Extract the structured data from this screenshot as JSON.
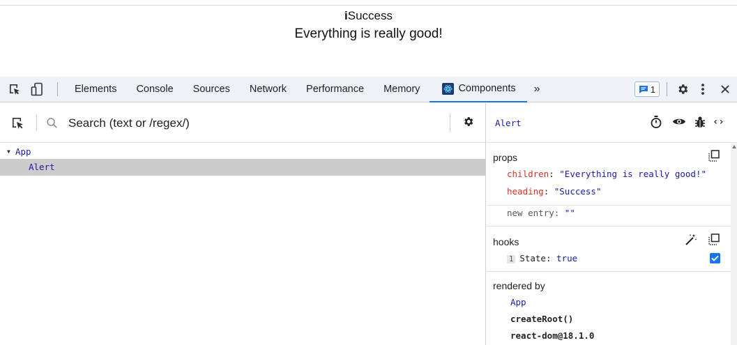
{
  "page": {
    "alert_icon_char": "i",
    "alert_heading": "Success",
    "alert_text": "Everything is really good!"
  },
  "devtools": {
    "tabs": [
      {
        "label": "Elements",
        "active": false
      },
      {
        "label": "Console",
        "active": false
      },
      {
        "label": "Sources",
        "active": false
      },
      {
        "label": "Network",
        "active": false
      },
      {
        "label": "Performance",
        "active": false
      },
      {
        "label": "Memory",
        "active": false
      },
      {
        "label": "Components",
        "active": true
      }
    ],
    "more_tabs_label": "»",
    "issues_count": "1",
    "accent_color": "#1a73e8"
  },
  "components": {
    "search": {
      "placeholder": "Search (text or /regex/)",
      "value": ""
    },
    "tree": {
      "root": "App",
      "child": "Alert"
    }
  },
  "inspector": {
    "selected": "Alert",
    "props": {
      "title": "props",
      "children_key": "children",
      "children_value": "\"Everything is really good!\"",
      "heading_key": "heading",
      "heading_value": "\"Success\"",
      "new_entry_key": "new entry",
      "new_entry_value": "\"\""
    },
    "hooks": {
      "title": "hooks",
      "index": "1",
      "name": "State:",
      "value": "true",
      "checked": true
    },
    "rendered_by": {
      "title": "rendered by",
      "items": [
        "App",
        "createRoot()",
        "react-dom@18.1.0"
      ]
    }
  }
}
